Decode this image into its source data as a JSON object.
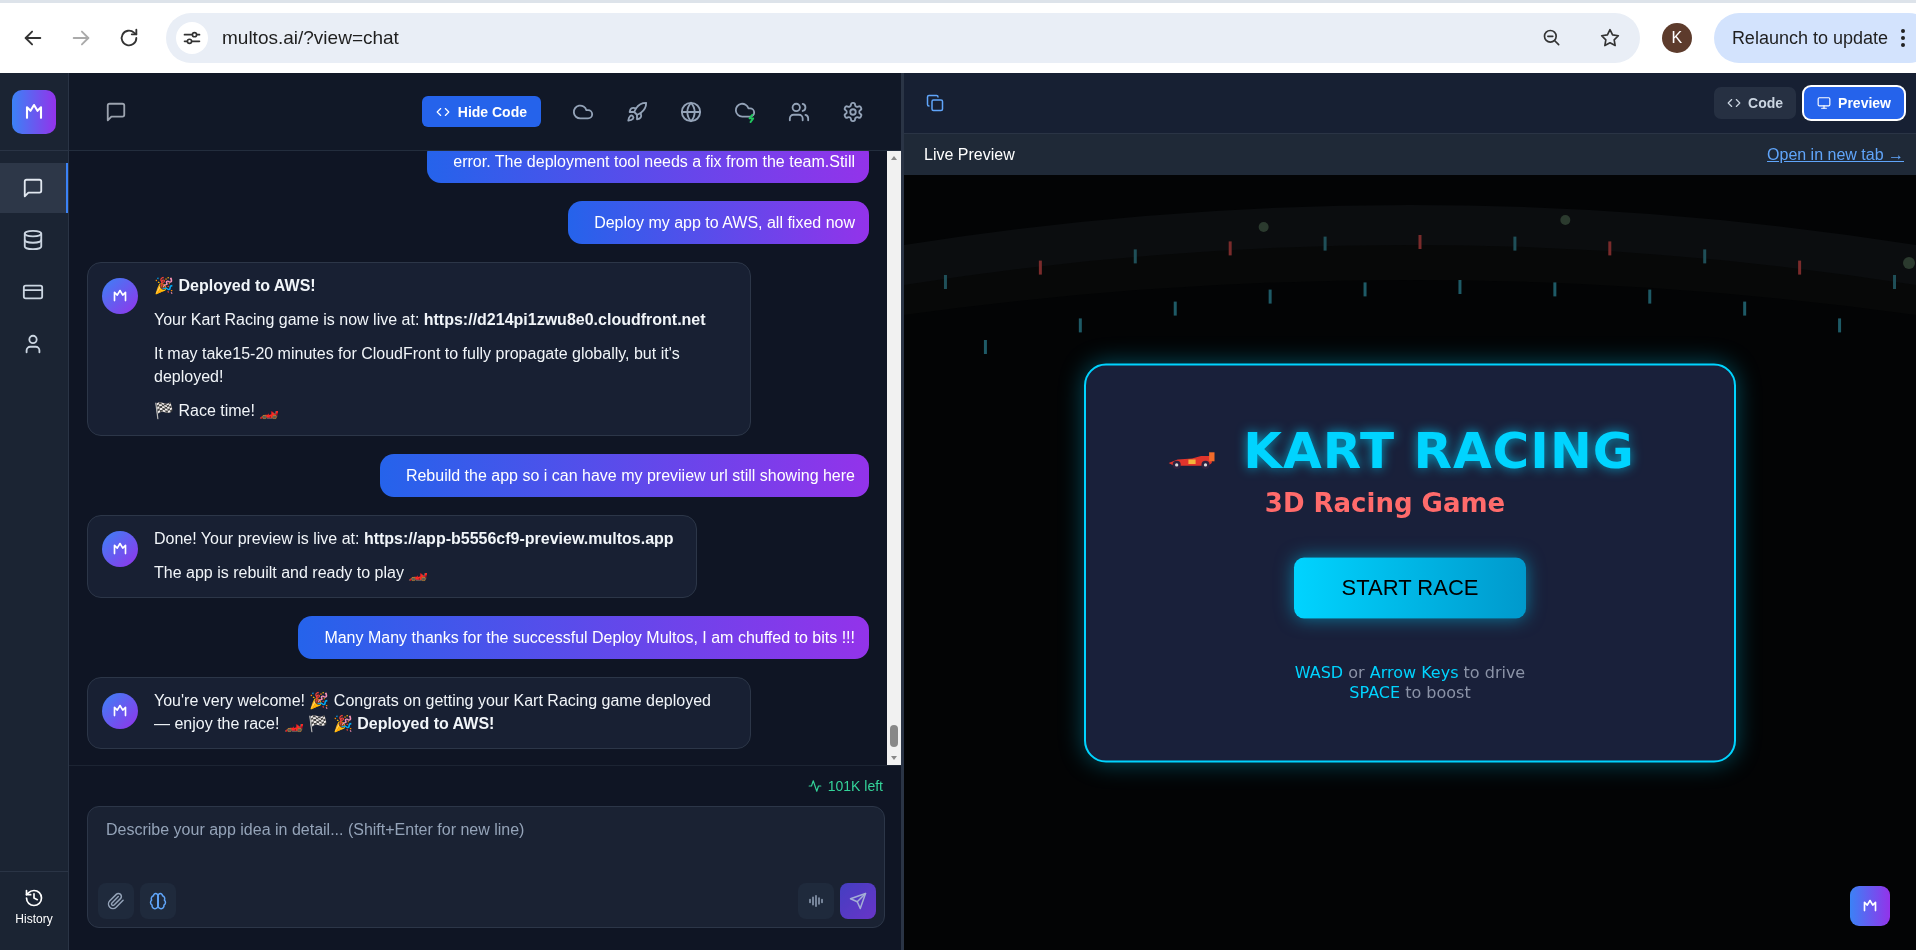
{
  "browser": {
    "nav": [
      {
        "kind": "back",
        "disabled": false
      },
      {
        "kind": "forward",
        "disabled": true
      },
      {
        "kind": "reload",
        "disabled": false
      }
    ],
    "url": "multos.ai/?view=chat",
    "profile_initial": "K",
    "relaunch_button": "Relaunch to update"
  },
  "rail": {
    "items": [
      {
        "kind": "chat",
        "selected": true
      },
      {
        "kind": "database",
        "selected": false
      },
      {
        "kind": "card",
        "selected": false
      },
      {
        "kind": "user",
        "selected": false
      }
    ],
    "history_label": "History"
  },
  "chat_header": {
    "hide_code_button": "Hide Code",
    "tools": [
      {
        "kind": "cloud"
      },
      {
        "kind": "rocket"
      },
      {
        "kind": "globe"
      },
      {
        "kind": "cloud-bolt"
      },
      {
        "kind": "users"
      },
      {
        "kind": "settings"
      }
    ]
  },
  "messages": [
    {
      "kind": "user",
      "paragraphs": [
        "error. The deployment tool needs a fix from the team.Still"
      ]
    },
    {
      "kind": "user",
      "paragraphs": [
        "Deploy my app to AWS, all fixed now"
      ]
    },
    {
      "kind": "assistant",
      "paragraphs": [
        "🎉 **Deployed to AWS!**",
        "Your Kart Racing game is now live at: **https://d214pi1zwu8e0.cloudfront.net**",
        "It may take15-20 minutes for CloudFront to fully propagate globally, but it's deployed!",
        "🏁 Race time! 🏎️"
      ]
    },
    {
      "kind": "user",
      "paragraphs": [
        "Rebuild the app so i can have my previiew url still showing here"
      ]
    },
    {
      "kind": "assistant",
      "paragraphs": [
        "Done! Your preview is live at: **https://app-b5556cf9-preview.multos.app**",
        "The app is rebuilt and ready to play 🏎️"
      ]
    },
    {
      "kind": "user",
      "paragraphs": [
        "Many Many thanks for the successful Deploy Multos, I am chuffed to bits !!!"
      ]
    },
    {
      "kind": "assistant",
      "paragraphs": [
        "You're very welcome! 🎉 Congrats on getting your Kart Racing game deployed — enjoy the race! 🏎️ 🏁 🎉 **Deployed to AWS!**"
      ]
    }
  ],
  "token_meter": "101K left",
  "composer": {
    "placeholder": "Describe your app idea in detail... (Shift+Enter for new line)"
  },
  "preview_panel": {
    "tabs": [
      {
        "label": "Code",
        "kind": "code",
        "selected": false
      },
      {
        "label": "Preview",
        "kind": "preview",
        "selected": true
      }
    ],
    "title": "Live Preview",
    "open_link": "Open in new tab →",
    "game": {
      "title": "KART RACING",
      "subtitle": "3D Racing Game",
      "start_button": "START RACE",
      "controls": [
        [
          {
            "text": "WASD",
            "key": true
          },
          {
            "text": " or ",
            "key": false
          },
          {
            "text": "Arrow Keys",
            "key": true
          },
          {
            "text": " to drive",
            "key": false
          }
        ],
        [
          {
            "text": "SPACE",
            "key": true
          },
          {
            "text": " to boost",
            "key": false
          }
        ]
      ]
    }
  }
}
